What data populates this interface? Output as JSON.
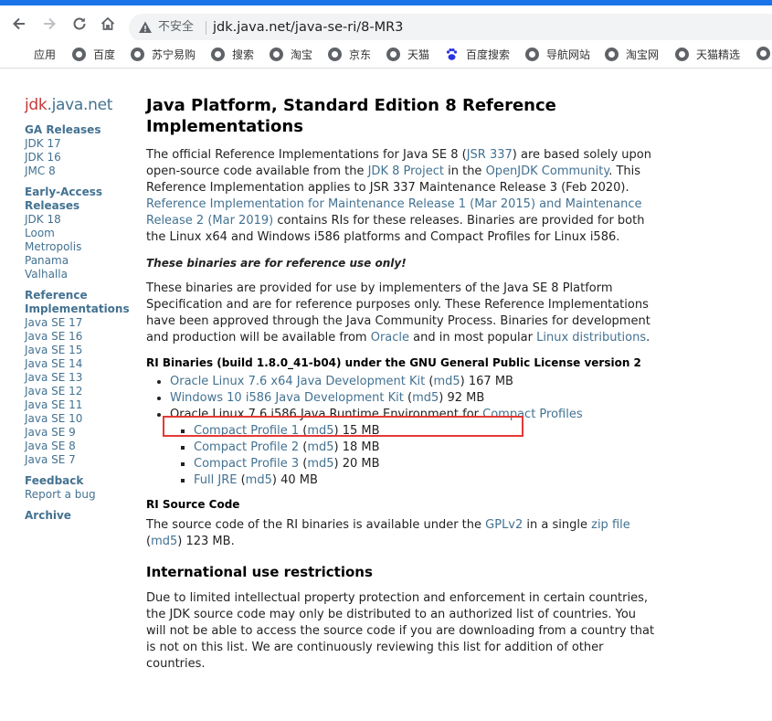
{
  "browser": {
    "insecure_label": "不安全",
    "url": "jdk.java.net/java-se-ri/8-MR3",
    "bookmarks": [
      "应用",
      "百度",
      "苏宁易购",
      "搜索",
      "淘宝",
      "京东",
      "天猫",
      "百度搜索",
      "导航网站",
      "淘宝网",
      "天猫精选"
    ]
  },
  "sidebar": {
    "logo_jdk": "jdk",
    "logo_rest": ".java.net",
    "ga_heading": "GA Releases",
    "ga_items": [
      "JDK 17",
      "JDK 16",
      "JMC 8"
    ],
    "ea_heading": "Early-Access Releases",
    "ea_items": [
      "JDK 18",
      "Loom",
      "Metropolis",
      "Panama",
      "Valhalla"
    ],
    "ri_heading": "Reference Implementations",
    "ri_items": [
      "Java SE 17",
      "Java SE 16",
      "Java SE 15",
      "Java SE 14",
      "Java SE 13",
      "Java SE 12",
      "Java SE 11",
      "Java SE 10",
      "Java SE 9",
      "Java SE 8",
      "Java SE 7"
    ],
    "feedback_heading": "Feedback",
    "feedback_item": "Report a bug",
    "archive": "Archive"
  },
  "content": {
    "title": "Java Platform, Standard Edition 8 Reference Implementations",
    "intro": {
      "t1": "The official Reference Implementations for Java SE 8 (",
      "l1": "JSR 337",
      "t2": ") are based solely upon open-source code available from the ",
      "l2": "JDK 8 Project",
      "t3": " in the ",
      "l3": "OpenJDK Community",
      "t4": ". This Reference Implementation applies to JSR 337 Maintenance Release 3 (Feb 2020). ",
      "l4": "Reference Implementation for Maintenance Release 1 (Mar 2015) and Maintenance Release 2 (Mar 2019)",
      "t5": " contains RIs for these releases. Binaries are provided for both the Linux x64 and Windows i586 platforms and Compact Profiles for Linux i586."
    },
    "note": "These binaries are for reference use only!",
    "para2": {
      "t1": "These binaries are provided for use by implementers of the Java SE 8 Platform Specification and are for reference purposes only. These Reference Implementations have been approved through the Java Community Process. Binaries for development and production will be available from ",
      "l1": "Oracle",
      "t2": " and in most popular ",
      "l2": "Linux distributions",
      "t3": "."
    },
    "binaries_heading": "RI Binaries (build 1.8.0_41-b04) under the GNU General Public License version 2",
    "binaries": {
      "b1_link": "Oracle Linux 7.6 x64 Java Development Kit",
      "b1_md5": "md5",
      "b1_size": "167 MB",
      "b2_link": "Windows 10 i586 Java Development Kit",
      "b2_md5": "md5",
      "b2_size": "92 MB",
      "b3_text": "Oracle Linux 7.6 i586 Java Runtime Environment for ",
      "b3_link": "Compact Profiles",
      "profiles": [
        {
          "label": "Compact Profile 1",
          "md5": "md5",
          "size": "15 MB"
        },
        {
          "label": "Compact Profile 2",
          "md5": "md5",
          "size": "18 MB"
        },
        {
          "label": "Compact Profile 3",
          "md5": "md5",
          "size": "20 MB"
        },
        {
          "label": "Full JRE",
          "md5": "md5",
          "size": "40 MB"
        }
      ]
    },
    "source_heading": "RI Source Code",
    "source": {
      "t1": "The source code of the RI binaries is available under the ",
      "l1": "GPLv2",
      "t2": " in a single ",
      "l2": "zip file",
      "l3": "md5",
      "t3": "123 MB."
    },
    "intl_heading": "International use restrictions",
    "intl_text": "Due to limited intellectual property protection and enforcement in certain countries, the JDK source code may only be distributed to an authorized list of countries. You will not be able to access the source code if you are downloading from a country that is not on this list. We are continuously reviewing this list for addition of other countries."
  },
  "colors": {
    "link": "#437291",
    "logo_red": "#c73838",
    "highlight": "#e53935",
    "tab_strip": "#1a73e8"
  }
}
